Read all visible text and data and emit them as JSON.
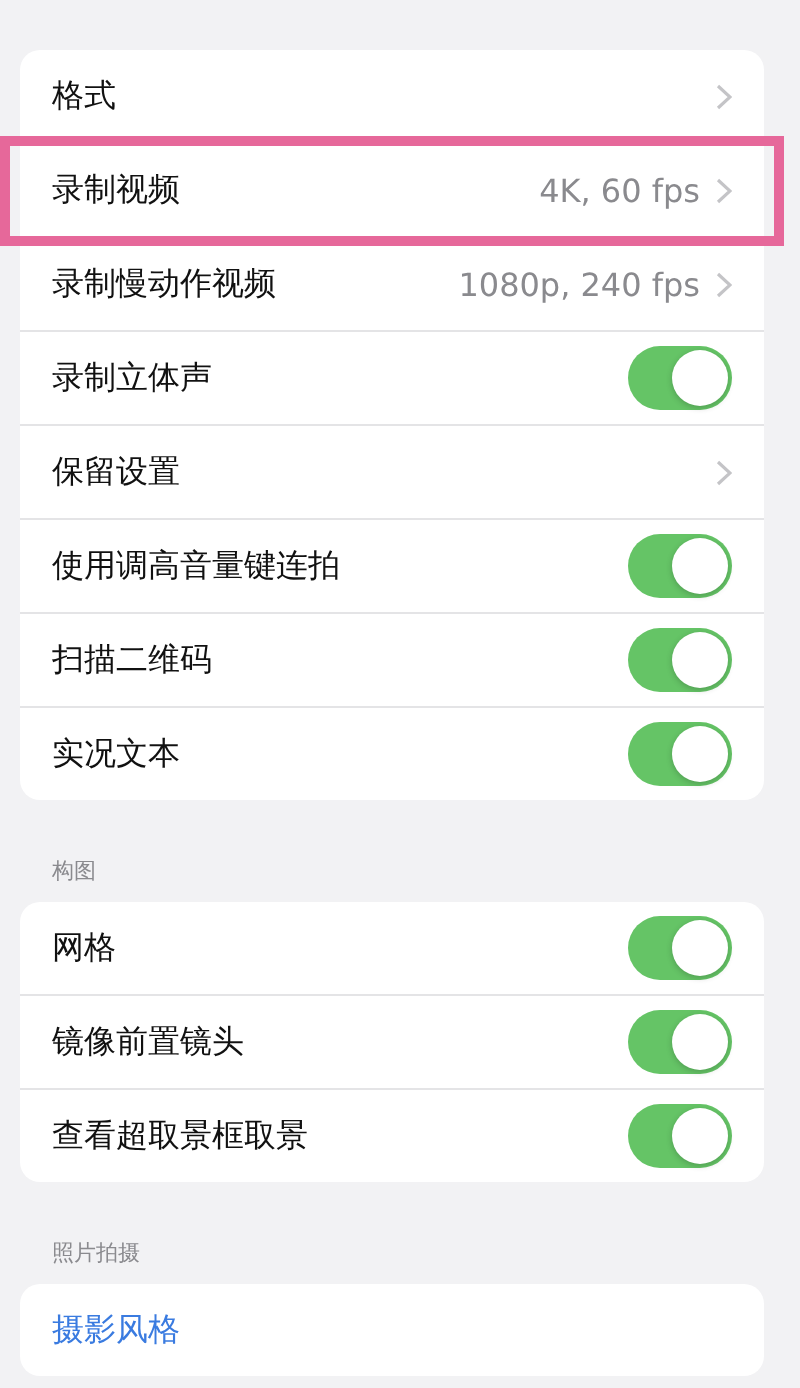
{
  "groups": [
    {
      "rows": [
        {
          "kind": "link",
          "label": "格式",
          "highlighted": false
        },
        {
          "kind": "link",
          "label": "录制视频",
          "value": "4K, 60 fps",
          "highlighted": true
        },
        {
          "kind": "link",
          "label": "录制慢动作视频",
          "value": "1080p, 240 fps",
          "highlighted": false
        },
        {
          "kind": "toggle",
          "label": "录制立体声",
          "on": true,
          "highlighted": false
        },
        {
          "kind": "link",
          "label": "保留设置",
          "highlighted": false
        },
        {
          "kind": "toggle",
          "label": "使用调高音量键连拍",
          "on": true,
          "highlighted": false
        },
        {
          "kind": "toggle",
          "label": "扫描二维码",
          "on": true,
          "highlighted": false
        },
        {
          "kind": "toggle",
          "label": "实况文本",
          "on": true,
          "highlighted": false
        }
      ]
    },
    {
      "header": "构图",
      "rows": [
        {
          "kind": "toggle",
          "label": "网格",
          "on": true,
          "highlighted": false
        },
        {
          "kind": "toggle",
          "label": "镜像前置镜头",
          "on": true,
          "highlighted": false
        },
        {
          "kind": "toggle",
          "label": "查看超取景框取景",
          "on": true,
          "highlighted": false
        }
      ]
    },
    {
      "header": "照片拍摄",
      "rows": [
        {
          "kind": "action",
          "label": "摄影风格",
          "highlighted": false
        }
      ]
    }
  ]
}
